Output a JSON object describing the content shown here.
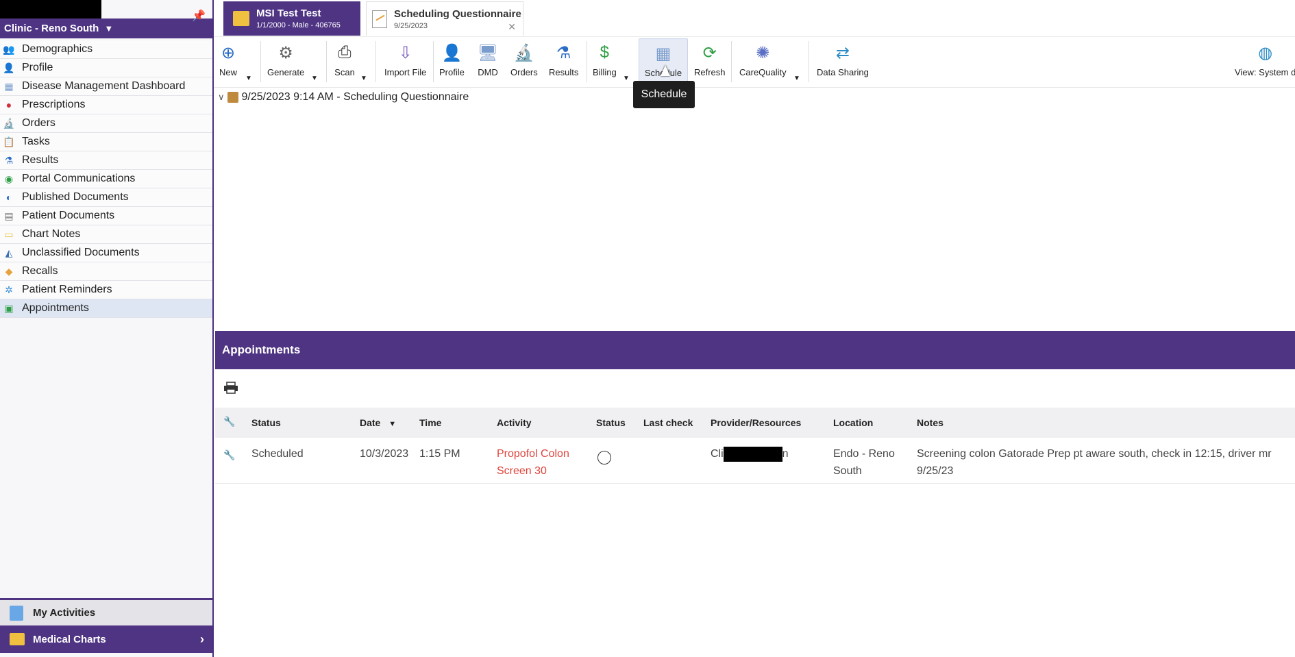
{
  "sidebar": {
    "clinic_label": "Clinic - Reno South",
    "items": [
      {
        "label": "Demographics",
        "icon": "people-icon"
      },
      {
        "label": "Profile",
        "icon": "person-icon"
      },
      {
        "label": "Disease Management Dashboard",
        "icon": "dashboard-icon"
      },
      {
        "label": "Prescriptions",
        "icon": "pill-icon"
      },
      {
        "label": "Orders",
        "icon": "microscope-icon"
      },
      {
        "label": "Tasks",
        "icon": "clipboard-icon"
      },
      {
        "label": "Results",
        "icon": "flask-icon"
      },
      {
        "label": "Portal Communications",
        "icon": "portal-icon"
      },
      {
        "label": "Published Documents",
        "icon": "published-icon"
      },
      {
        "label": "Patient Documents",
        "icon": "documents-icon"
      },
      {
        "label": "Chart Notes",
        "icon": "note-icon"
      },
      {
        "label": "Unclassified Documents",
        "icon": "unclassified-icon"
      },
      {
        "label": "Recalls",
        "icon": "recall-icon"
      },
      {
        "label": "Patient Reminders",
        "icon": "reminder-icon"
      },
      {
        "label": "Appointments",
        "icon": "appointment-icon"
      }
    ],
    "my_activities": "My Activities",
    "medical_charts": "Medical Charts"
  },
  "tabs": {
    "patient": {
      "title": "MSI Test Test",
      "subtitle": "1/1/2000 - Male - 406765"
    },
    "document": {
      "title": "Scheduling Questionnaire",
      "subtitle": "9/25/2023"
    }
  },
  "toolbar": {
    "new": "New",
    "generate": "Generate",
    "scan": "Scan",
    "import_file": "Import File",
    "profile": "Profile",
    "dmd": "DMD",
    "orders": "Orders",
    "results": "Results",
    "billing": "Billing",
    "schedule": "Schedule",
    "refresh": "Refresh",
    "carequality": "CareQuality",
    "data_sharing": "Data Sharing",
    "view": "View: System d",
    "tooltip": "Schedule"
  },
  "encounter": {
    "label": "9/25/2023 9:14 AM - Scheduling Questionnaire"
  },
  "appointments": {
    "header": "Appointments",
    "columns": [
      "Status",
      "Date",
      "Time",
      "Activity",
      "Status",
      "Last check",
      "Provider/Resources",
      "Location",
      "Notes"
    ],
    "rows": [
      {
        "status": "Scheduled",
        "date": "10/3/2023",
        "time": "1:15 PM",
        "activity_line1": "Propofol Colon",
        "activity_line2": "Screen 30",
        "last_check": "",
        "provider_prefix": "Cli",
        "provider_suffix": "n",
        "location_line1": "Endo - Reno",
        "location_line2": "South",
        "notes": "Screening colon Gatorade Prep pt aware south, check in 12:15, driver mr 9/25/23"
      }
    ]
  },
  "colors": {
    "brand_purple": "#4e3483",
    "activity_red": "#e0433b"
  }
}
